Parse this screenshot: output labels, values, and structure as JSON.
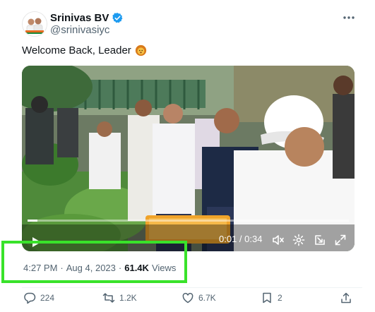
{
  "author": {
    "name": "Srinivas BV",
    "handle": "@srinivasiyc",
    "verified": true,
    "badge_color": "#1d9bf0"
  },
  "tweet": {
    "text": "Welcome Back, Leader",
    "emoji": "lion-face"
  },
  "video": {
    "current_time": "0:01",
    "duration": "0:34",
    "time_display": "0:01 / 0:34",
    "progress": 0.03
  },
  "meta": {
    "time": "4:27 PM",
    "date": "Aug 4, 2023",
    "views_count": "61.4K",
    "views_label": "Views",
    "highlight_color": "#39e22a"
  },
  "actions": {
    "replies": "224",
    "reposts": "1.2K",
    "likes": "6.7K",
    "bookmarks": "2"
  },
  "icons": [
    "verified-badge-icon",
    "more-icon",
    "lion-emoji",
    "play-icon",
    "mute-icon",
    "settings-icon",
    "pip-icon",
    "fullscreen-icon",
    "reply-icon",
    "repost-icon",
    "like-icon",
    "bookmark-icon",
    "share-icon"
  ]
}
